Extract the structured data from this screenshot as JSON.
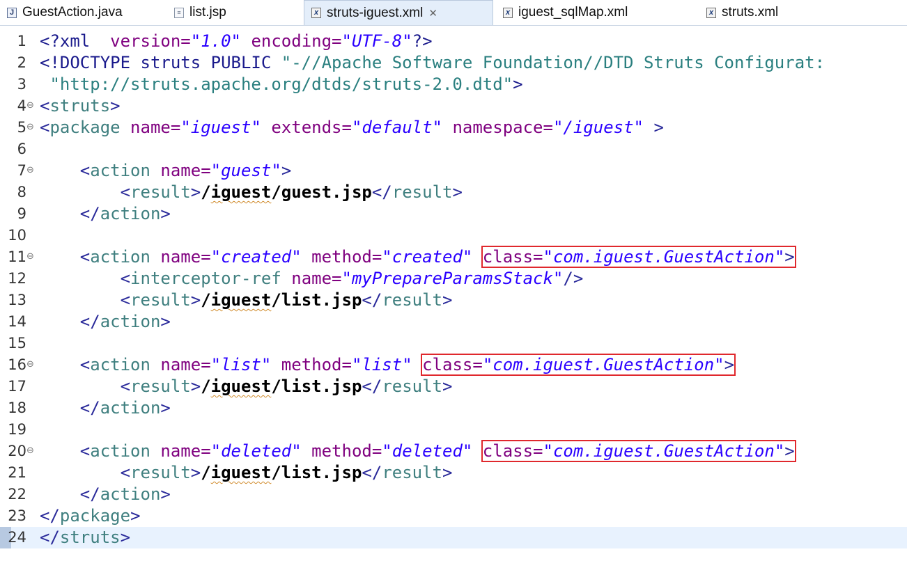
{
  "tabs": [
    {
      "label": "GuestAction.java",
      "icon": "java-file-icon",
      "active": false
    },
    {
      "label": "list.jsp",
      "icon": "jsp-file-icon",
      "active": false
    },
    {
      "label": "struts-iguest.xml",
      "icon": "xml-file-icon",
      "active": true,
      "close": "✕"
    },
    {
      "label": "iguest_sqlMap.xml",
      "icon": "xml-file-icon",
      "active": false
    },
    {
      "label": "struts.xml",
      "icon": "xml-file-icon",
      "active": false
    }
  ],
  "editor": {
    "lines": [
      {
        "n": "1",
        "fold": false,
        "current": false,
        "segments": [
          {
            "c": "p",
            "t": "<?xml "
          },
          {
            "c": "a",
            "t": " version="
          },
          {
            "c": "v",
            "t": "\"1.0\""
          },
          {
            "c": "a",
            "t": " encoding="
          },
          {
            "c": "v",
            "t": "\"UTF-8\""
          },
          {
            "c": "p",
            "t": "?>"
          }
        ]
      },
      {
        "n": "2",
        "fold": false,
        "current": false,
        "segments": [
          {
            "c": "p",
            "t": "<!DOCTYPE struts PUBLIC "
          },
          {
            "c": "dt",
            "t": "\"-//Apache Software Foundation//DTD Struts Configurat:"
          }
        ]
      },
      {
        "n": "3",
        "fold": false,
        "current": false,
        "segments": [
          {
            "c": "dt",
            "t": " \"http://struts.apache.org/dtds/struts-2.0.dtd\""
          },
          {
            "c": "p",
            "t": ">"
          }
        ]
      },
      {
        "n": "4",
        "fold": true,
        "current": false,
        "segments": [
          {
            "c": "t",
            "t": "<"
          },
          {
            "c": "tn",
            "t": "struts"
          },
          {
            "c": "t",
            "t": ">"
          }
        ]
      },
      {
        "n": "5",
        "fold": true,
        "current": false,
        "segments": [
          {
            "c": "t",
            "t": "<"
          },
          {
            "c": "tn",
            "t": "package"
          },
          {
            "c": "a",
            "t": " name="
          },
          {
            "c": "v",
            "t": "\"iguest\""
          },
          {
            "c": "a",
            "t": " extends="
          },
          {
            "c": "v",
            "t": "\"default\""
          },
          {
            "c": "a",
            "t": " namespace="
          },
          {
            "c": "v",
            "t": "\"/iguest\""
          },
          {
            "c": "t",
            "t": " >"
          }
        ]
      },
      {
        "n": "6",
        "fold": false,
        "current": false,
        "segments": []
      },
      {
        "n": "7",
        "fold": true,
        "current": false,
        "segments": [
          {
            "c": "t",
            "t": "    <"
          },
          {
            "c": "tn",
            "t": "action"
          },
          {
            "c": "a",
            "t": " name="
          },
          {
            "c": "v",
            "t": "\"guest\""
          },
          {
            "c": "t",
            "t": ">"
          }
        ]
      },
      {
        "n": "8",
        "fold": false,
        "current": false,
        "segments": [
          {
            "c": "t",
            "t": "        <"
          },
          {
            "c": "tn",
            "t": "result"
          },
          {
            "c": "t",
            "t": ">"
          },
          {
            "c": "tx",
            "t": "/"
          },
          {
            "c": "tx squig",
            "t": "iguest"
          },
          {
            "c": "tx",
            "t": "/guest.jsp"
          },
          {
            "c": "t",
            "t": "</"
          },
          {
            "c": "tn",
            "t": "result"
          },
          {
            "c": "t",
            "t": ">"
          }
        ]
      },
      {
        "n": "9",
        "fold": false,
        "current": false,
        "segments": [
          {
            "c": "t",
            "t": "    </"
          },
          {
            "c": "tn",
            "t": "action"
          },
          {
            "c": "t",
            "t": ">"
          }
        ]
      },
      {
        "n": "10",
        "fold": false,
        "current": false,
        "segments": []
      },
      {
        "n": "11",
        "fold": true,
        "current": false,
        "segments": [
          {
            "c": "t",
            "t": "    <"
          },
          {
            "c": "tn",
            "t": "action"
          },
          {
            "c": "a",
            "t": " name="
          },
          {
            "c": "v",
            "t": "\"created\""
          },
          {
            "c": "a",
            "t": " method="
          },
          {
            "c": "v",
            "t": "\"created\""
          },
          {
            "c": "t",
            "t": " "
          },
          {
            "c": "a box",
            "t": "class=",
            "box": "start"
          },
          {
            "c": "v box",
            "t": "\"com.iguest.GuestAction\""
          },
          {
            "c": "t box",
            "t": ">",
            "box": "end"
          }
        ]
      },
      {
        "n": "12",
        "fold": false,
        "current": false,
        "segments": [
          {
            "c": "t",
            "t": "        <"
          },
          {
            "c": "tn",
            "t": "interceptor-ref"
          },
          {
            "c": "a",
            "t": " name="
          },
          {
            "c": "v",
            "t": "\"myPrepareParamsStack\""
          },
          {
            "c": "t",
            "t": "/>"
          }
        ]
      },
      {
        "n": "13",
        "fold": false,
        "current": false,
        "segments": [
          {
            "c": "t",
            "t": "        <"
          },
          {
            "c": "tn",
            "t": "result"
          },
          {
            "c": "t",
            "t": ">"
          },
          {
            "c": "tx",
            "t": "/"
          },
          {
            "c": "tx squig",
            "t": "iguest"
          },
          {
            "c": "tx",
            "t": "/list.jsp"
          },
          {
            "c": "t",
            "t": "</"
          },
          {
            "c": "tn",
            "t": "result"
          },
          {
            "c": "t",
            "t": ">"
          }
        ]
      },
      {
        "n": "14",
        "fold": false,
        "current": false,
        "segments": [
          {
            "c": "t",
            "t": "    </"
          },
          {
            "c": "tn",
            "t": "action"
          },
          {
            "c": "t",
            "t": ">"
          }
        ]
      },
      {
        "n": "15",
        "fold": false,
        "current": false,
        "segments": []
      },
      {
        "n": "16",
        "fold": true,
        "current": false,
        "segments": [
          {
            "c": "t",
            "t": "    <"
          },
          {
            "c": "tn",
            "t": "action"
          },
          {
            "c": "a",
            "t": " name="
          },
          {
            "c": "v",
            "t": "\"list\""
          },
          {
            "c": "a",
            "t": " method="
          },
          {
            "c": "v",
            "t": "\"list\""
          },
          {
            "c": "t",
            "t": " "
          },
          {
            "c": "a box",
            "t": "class=",
            "box": "start"
          },
          {
            "c": "v box",
            "t": "\"com.iguest.GuestAction\""
          },
          {
            "c": "t box",
            "t": ">",
            "box": "end"
          }
        ]
      },
      {
        "n": "17",
        "fold": false,
        "current": false,
        "segments": [
          {
            "c": "t",
            "t": "        <"
          },
          {
            "c": "tn",
            "t": "result"
          },
          {
            "c": "t",
            "t": ">"
          },
          {
            "c": "tx",
            "t": "/"
          },
          {
            "c": "tx squig",
            "t": "iguest"
          },
          {
            "c": "tx",
            "t": "/list.jsp"
          },
          {
            "c": "t",
            "t": "</"
          },
          {
            "c": "tn",
            "t": "result"
          },
          {
            "c": "t",
            "t": ">"
          }
        ]
      },
      {
        "n": "18",
        "fold": false,
        "current": false,
        "segments": [
          {
            "c": "t",
            "t": "    </"
          },
          {
            "c": "tn",
            "t": "action"
          },
          {
            "c": "t",
            "t": ">"
          }
        ]
      },
      {
        "n": "19",
        "fold": false,
        "current": false,
        "segments": []
      },
      {
        "n": "20",
        "fold": true,
        "current": false,
        "segments": [
          {
            "c": "t",
            "t": "    <"
          },
          {
            "c": "tn",
            "t": "action"
          },
          {
            "c": "a",
            "t": " name="
          },
          {
            "c": "v",
            "t": "\"deleted\""
          },
          {
            "c": "a",
            "t": " method="
          },
          {
            "c": "v",
            "t": "\"deleted\""
          },
          {
            "c": "t",
            "t": " "
          },
          {
            "c": "a box",
            "t": "class=",
            "box": "start"
          },
          {
            "c": "v box",
            "t": "\"com.iguest.GuestAction\""
          },
          {
            "c": "t box",
            "t": ">",
            "box": "end"
          }
        ]
      },
      {
        "n": "21",
        "fold": false,
        "current": false,
        "segments": [
          {
            "c": "t",
            "t": "        <"
          },
          {
            "c": "tn",
            "t": "result"
          },
          {
            "c": "t",
            "t": ">"
          },
          {
            "c": "tx",
            "t": "/"
          },
          {
            "c": "tx squig",
            "t": "iguest"
          },
          {
            "c": "tx",
            "t": "/list.jsp"
          },
          {
            "c": "t",
            "t": "</"
          },
          {
            "c": "tn",
            "t": "result"
          },
          {
            "c": "t",
            "t": ">"
          }
        ]
      },
      {
        "n": "22",
        "fold": false,
        "current": false,
        "segments": [
          {
            "c": "t",
            "t": "    </"
          },
          {
            "c": "tn",
            "t": "action"
          },
          {
            "c": "t",
            "t": ">"
          }
        ]
      },
      {
        "n": "23",
        "fold": false,
        "current": false,
        "segments": [
          {
            "c": "t",
            "t": "</"
          },
          {
            "c": "tn",
            "t": "package"
          },
          {
            "c": "t",
            "t": ">"
          }
        ]
      },
      {
        "n": "24",
        "fold": false,
        "current": true,
        "segments": [
          {
            "c": "t",
            "t": "</"
          },
          {
            "c": "tn",
            "t": "struts"
          },
          {
            "c": "t",
            "t": ">"
          }
        ]
      }
    ]
  },
  "colors": {
    "highlight_box": "#e0282d",
    "active_tab": "#e4eefa",
    "current_line": "#e8f2fe"
  }
}
